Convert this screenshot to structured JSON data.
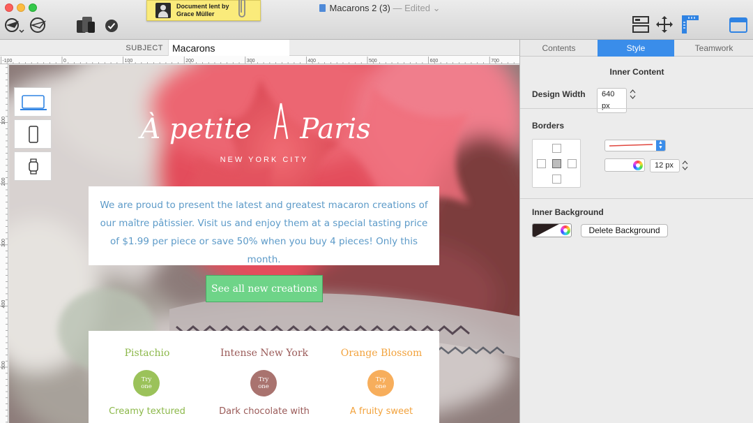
{
  "window": {
    "title": "Macarons 2 (3)",
    "edited_label": "— Edited"
  },
  "sticky_note": {
    "line1": "Document lent by",
    "line2": "Grace Müller"
  },
  "subject": {
    "label": "SUBJECT",
    "value": "Macarons"
  },
  "rulers": {
    "top_ticks": [
      "-100",
      "0",
      "100",
      "200",
      "300",
      "400",
      "500",
      "600",
      "700"
    ],
    "left_ticks": [
      "100",
      "200",
      "300",
      "400",
      "500"
    ]
  },
  "email": {
    "brand_left": "À petite",
    "brand_right": "Paris",
    "tagline": "NEW YORK CITY",
    "intro": "We are proud to present the latest and greatest macaron creations of our maître pâtissier. Visit us and enjoy them at a special tasting price of $1.99 per piece or save 50% when you buy 4 pieces! Only this month.",
    "cta": "See all new creations",
    "products": [
      {
        "name": "Pistachio",
        "try_line1": "Try",
        "try_line2": "one",
        "desc": "Creamy textured",
        "color": "#8cb84a",
        "circle": "#9bc25a"
      },
      {
        "name": "Intense New York",
        "try_line1": "Try",
        "try_line2": "one",
        "desc": "Dark chocolate with",
        "color": "#9a5a58",
        "circle": "#a9736f"
      },
      {
        "name": "Orange Blossom",
        "try_line1": "Try",
        "try_line2": "one",
        "desc": "A fruity sweet",
        "color": "#f2a23c",
        "circle": "#f7ae5c"
      }
    ]
  },
  "sidebar": {
    "tabs": [
      "Contents",
      "Style",
      "Teamwork"
    ],
    "active_tab": "Style",
    "inner_content": {
      "title": "Inner Content",
      "design_width_label": "Design Width",
      "design_width_value": "640 px"
    },
    "borders": {
      "title": "Borders",
      "line_color": "#e0463e",
      "width_value": "12 px"
    },
    "inner_background": {
      "title": "Inner Background",
      "delete_label": "Delete Background"
    }
  },
  "colors": {
    "accent": "#3a8dea",
    "intro_text": "#5c9ac8",
    "cta_bg": "#6ed488"
  }
}
